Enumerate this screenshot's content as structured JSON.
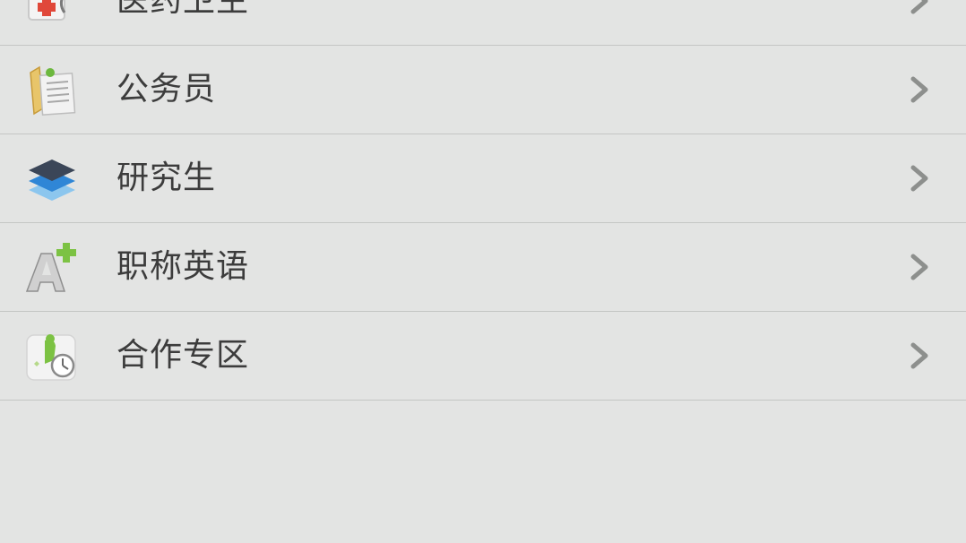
{
  "list": {
    "items": [
      {
        "label": "医药卫生",
        "icon": "medical-kit-icon"
      },
      {
        "label": "公务员",
        "icon": "civil-servant-folder-icon"
      },
      {
        "label": "研究生",
        "icon": "graduate-layers-icon"
      },
      {
        "label": "职称英语",
        "icon": "english-a-plus-icon"
      },
      {
        "label": "合作专区",
        "icon": "cooperation-zone-icon"
      }
    ],
    "chevron_icon": "chevron-right-icon"
  },
  "colors": {
    "background": "#e3e4e3",
    "divider": "#c4c6c4",
    "text": "#3c3c3c",
    "chevron": "#8d8f8d"
  }
}
